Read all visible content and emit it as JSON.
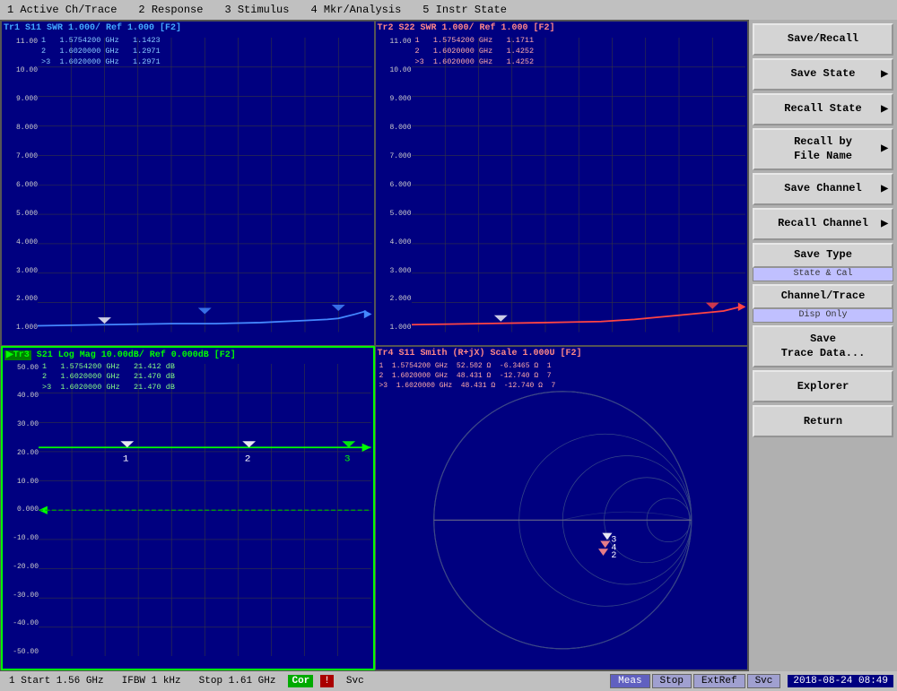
{
  "menu": {
    "items": [
      "1 Active Ch/Trace",
      "2 Response",
      "3 Stimulus",
      "4 Mkr/Analysis",
      "5 Instr State"
    ]
  },
  "plots": {
    "tr1": {
      "title": "Tr1 S11 SWR 1.000/ Ref 1.000 [F2]",
      "color": "blue",
      "markers": [
        {
          "num": "1",
          "freq": "1.5754200 GHz",
          "val": "1.1423"
        },
        {
          "num": "2",
          "freq": "1.6020000 GHz",
          "val": "1.2971"
        },
        {
          "num": ">3",
          "freq": "1.6020000 GHz",
          "val": "1.2971"
        }
      ],
      "y_max": "11.00",
      "y_vals": [
        "11.00",
        "10.00",
        "9.000",
        "8.000",
        "7.000",
        "6.000",
        "5.000",
        "4.000",
        "3.000",
        "2.000",
        "1.000"
      ]
    },
    "tr2": {
      "title": "Tr2 S22 SWR 1.000/ Ref 1.000 [F2]",
      "color": "red",
      "markers": [
        {
          "num": "1",
          "freq": "1.5754200 GHz",
          "val": "1.1711"
        },
        {
          "num": "2",
          "freq": "1.6020000 GHz",
          "val": "1.4252"
        },
        {
          "num": ">3",
          "freq": "1.6020000 GHz",
          "val": "1.4252"
        }
      ],
      "y_max": "11.00",
      "y_vals": [
        "11.00",
        "10.00",
        "9.000",
        "8.000",
        "7.000",
        "6.000",
        "5.000",
        "4.000",
        "3.000",
        "2.000",
        "1.000"
      ]
    },
    "tr3": {
      "title": "Tr3 S21 Log Mag 10.00dB/ Ref 0.000dB [F2]",
      "color": "green",
      "active": true,
      "markers": [
        {
          "num": "1",
          "freq": "1.5754200 GHz",
          "val": "21.412 dB"
        },
        {
          "num": "2",
          "freq": "1.6020000 GHz",
          "val": "21.470 dB"
        },
        {
          "num": ">3",
          "freq": "1.6020000 GHz",
          "val": "21.470 dB"
        }
      ],
      "y_vals": [
        "50.00",
        "40.00",
        "30.00",
        "20.00",
        "10.00",
        "0.000",
        "-10.00",
        "-20.00",
        "-30.00",
        "-40.00",
        "-50.00"
      ]
    },
    "tr4": {
      "title": "Tr4 S11 Smith (R+jX) Scale 1.000U [F2]",
      "color": "red",
      "markers": [
        {
          "num": "1",
          "freq": "1.5754200 GHz",
          "val1": "52.502 Ω",
          "val2": "-6.3465 Ω",
          "val3": "1"
        },
        {
          "num": "2",
          "freq": "1.6020000 GHz",
          "val1": "48.431 Ω",
          "val2": "-12.740 Ω",
          "val3": "7"
        },
        {
          "num": ">3",
          "freq": "1.6020000 GHz",
          "val1": "48.431 Ω",
          "val2": "-12.740 Ω",
          "val3": "7"
        }
      ]
    }
  },
  "right_panel": {
    "buttons": [
      {
        "label": "Save/Recall",
        "id": "save-recall",
        "arrow": false
      },
      {
        "label": "Save State",
        "id": "save-state",
        "arrow": true
      },
      {
        "label": "Recall State",
        "id": "recall-state",
        "arrow": true
      },
      {
        "label": "Recall by\nFile Name",
        "id": "recall-by-filename",
        "arrow": true
      },
      {
        "label": "Save Channel",
        "id": "save-channel",
        "arrow": true
      },
      {
        "label": "Recall Channel",
        "id": "recall-channel",
        "arrow": true
      },
      {
        "label": "Save Type",
        "id": "save-type",
        "arrow": false
      },
      {
        "label": "Channel/Trace",
        "id": "channel-trace",
        "arrow": false
      },
      {
        "label": "Save\nTrace Data...",
        "id": "save-trace-data",
        "arrow": false
      },
      {
        "label": "Explorer",
        "id": "explorer",
        "arrow": false
      },
      {
        "label": "Return",
        "id": "return",
        "arrow": false
      }
    ],
    "save_type_sub": "State & Cal",
    "channel_trace_sub": "Disp Only"
  },
  "status_bar": {
    "start": "1 Start 1.56 GHz",
    "ifbw": "IFBW 1 kHz",
    "stop": "Stop 1.61 GHz",
    "cor": "Cor",
    "warning": "!",
    "svc": "Svc",
    "tabs": [
      "Meas",
      "Stop",
      "ExtRef",
      "Svc"
    ],
    "active_tab": "Meas",
    "time": "2018-08-24 08:49"
  }
}
